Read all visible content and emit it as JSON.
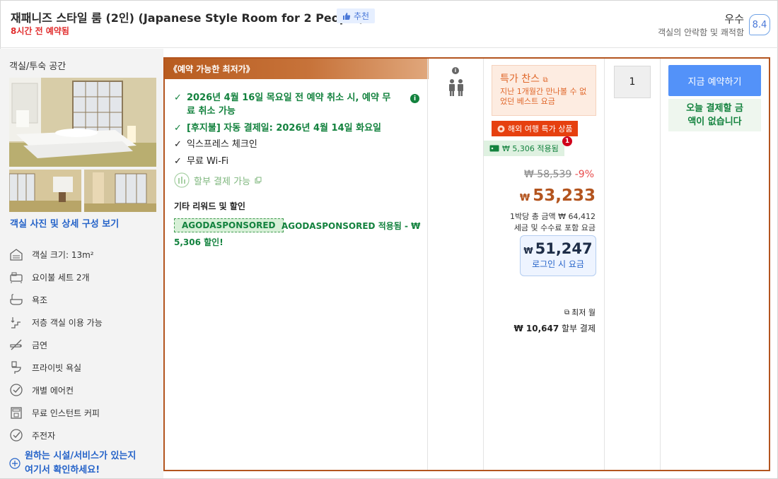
{
  "header": {
    "title": "재패니즈 스타일 룸 (2인) (Japanese Style Room for 2 People)",
    "recommend_label": "추천",
    "booked_note": "8시간 전 예약됨",
    "rating_word": "우수",
    "rating_sub": "객실의 안락함 및 쾌적함",
    "rating_score": "8.4"
  },
  "left": {
    "section_title": "객실/투숙 공간",
    "photos_link": "객실 사진 및 상세 구성 보기",
    "amenities": [
      {
        "icon": "room-size-icon",
        "label": "객실 크기: 13m²"
      },
      {
        "icon": "futon-icon",
        "label": "요이불 세트 2개"
      },
      {
        "icon": "bathtub-icon",
        "label": "욕조"
      },
      {
        "icon": "low-floor-icon",
        "label": "저층 객실 이용 가능"
      },
      {
        "icon": "no-smoking-icon",
        "label": "금연"
      },
      {
        "icon": "private-bath-icon",
        "label": "프라이빗 욕실"
      },
      {
        "icon": "check-circle-icon",
        "label": "개별 에어컨"
      },
      {
        "icon": "coffee-machine-icon",
        "label": "무료 인스턴트 커피"
      },
      {
        "icon": "check-circle-icon",
        "label": "주전자"
      }
    ],
    "find_more_line1": "원하는 시설/서비스가 있는지",
    "find_more_line2": "여기서 확인하세요!"
  },
  "offer": {
    "banner": "《예약 가능한 최저가》",
    "conditions": {
      "cancel_line1": "2026년 4월 16일 목요일 전 예약 취소 시, 예약 무",
      "cancel_line2": "료 취소 가능",
      "autopay": "[후지불] 자동 결제일: 2026년 4월 14일 화요일",
      "checkin": "익스프레스 체크인",
      "wifi": "무료 Wi-Fi",
      "installment": "할부 결제 가능"
    },
    "other_title": "기타 리워드 및 할인",
    "promo_code": "AGODASPONSORED",
    "promo_text1": "AGODASPONSORED 적용됨 - ₩",
    "promo_text2": "5,306 할인!",
    "occupancy": 2,
    "special_title": "특가 찬스",
    "special_sub": "지난 1개월간 만나볼 수 없었던 베스트 요금",
    "overseas_deal": "해외 여행 특가 상품",
    "applied_label": "₩ 5,306 적용됨",
    "applied_count": "1",
    "original_price": "₩ 58,539",
    "discount_pct": "-9%",
    "currency": "₩",
    "price": "53,233",
    "total_per_night": "1박당 총 금액 ₩ 64,412",
    "tax_note": "세금 및 수수료 포함 요금",
    "login_price": "51,247",
    "login_label": "로그인 시 요금",
    "monthly_label": "최저 월",
    "monthly_amount": "₩ 10,647",
    "monthly_suffix": "할부 결제",
    "quantity": "1",
    "book_button": "지금 예약하기",
    "pay_note_line1": "오늘 결제할 금",
    "pay_note_line2": "액이 없습니다"
  },
  "colors": {
    "brand_orange": "#b3541e",
    "link_blue": "#2563c9",
    "book_blue": "#5392f9",
    "green": "#13823e",
    "deal_red": "#e6400f"
  }
}
